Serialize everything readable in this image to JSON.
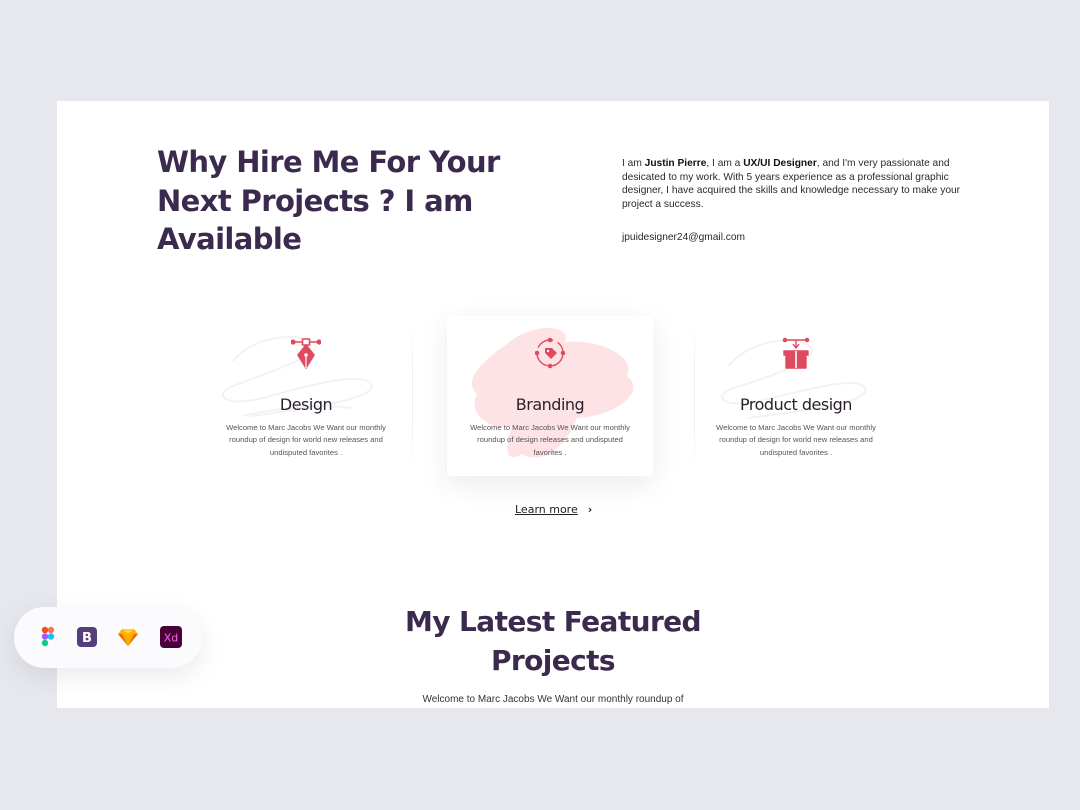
{
  "hero": {
    "title_lines": [
      "Why Hire Me For Your",
      "Next Projects ? I am",
      "Available"
    ],
    "bio": {
      "p1": "I am ",
      "name": "Justin Pierre",
      "p2": ", I am a ",
      "role": "UX/UI Designer",
      "p3": ", and I'm very passionate and desicated to my work. With 5 years experience as a professional graphic designer, I have acquired the skills and knowledge necessary to make your project a success."
    },
    "email": "jpuidesigner24@gmail.com"
  },
  "services": [
    {
      "title": "Design",
      "desc": "Welcome to Marc Jacobs We Want our monthly roundup of design for world new releases and undisputed favorites .",
      "icon": "pen-tool-icon"
    },
    {
      "title": "Branding",
      "desc": "Welcome to Marc Jacobs We Want our monthly roundup of design releases and undisputed favorites .",
      "icon": "tag-icon"
    },
    {
      "title": "Product design",
      "desc": "Welcome to Marc Jacobs We Want our monthly roundup of design for world new releases and undisputed favorites .",
      "icon": "box-icon"
    }
  ],
  "learn_more": {
    "label": "Learn more",
    "chevron": "›"
  },
  "projects": {
    "title_lines": [
      "My Latest Featured",
      "Projects"
    ],
    "desc": "Welcome to Marc Jacobs We Want our monthly roundup of"
  },
  "toolbar": {
    "tools": [
      "figma-icon",
      "bootstrap-icon",
      "sketch-icon",
      "xd-icon"
    ],
    "bootstrap_glyph": "B",
    "xd_glyph": "Xd"
  },
  "colors": {
    "heading": "#3b2a4d",
    "accent": "#e04a5f",
    "accent_soft": "#fde3e6",
    "background": "#e6e8ed"
  }
}
